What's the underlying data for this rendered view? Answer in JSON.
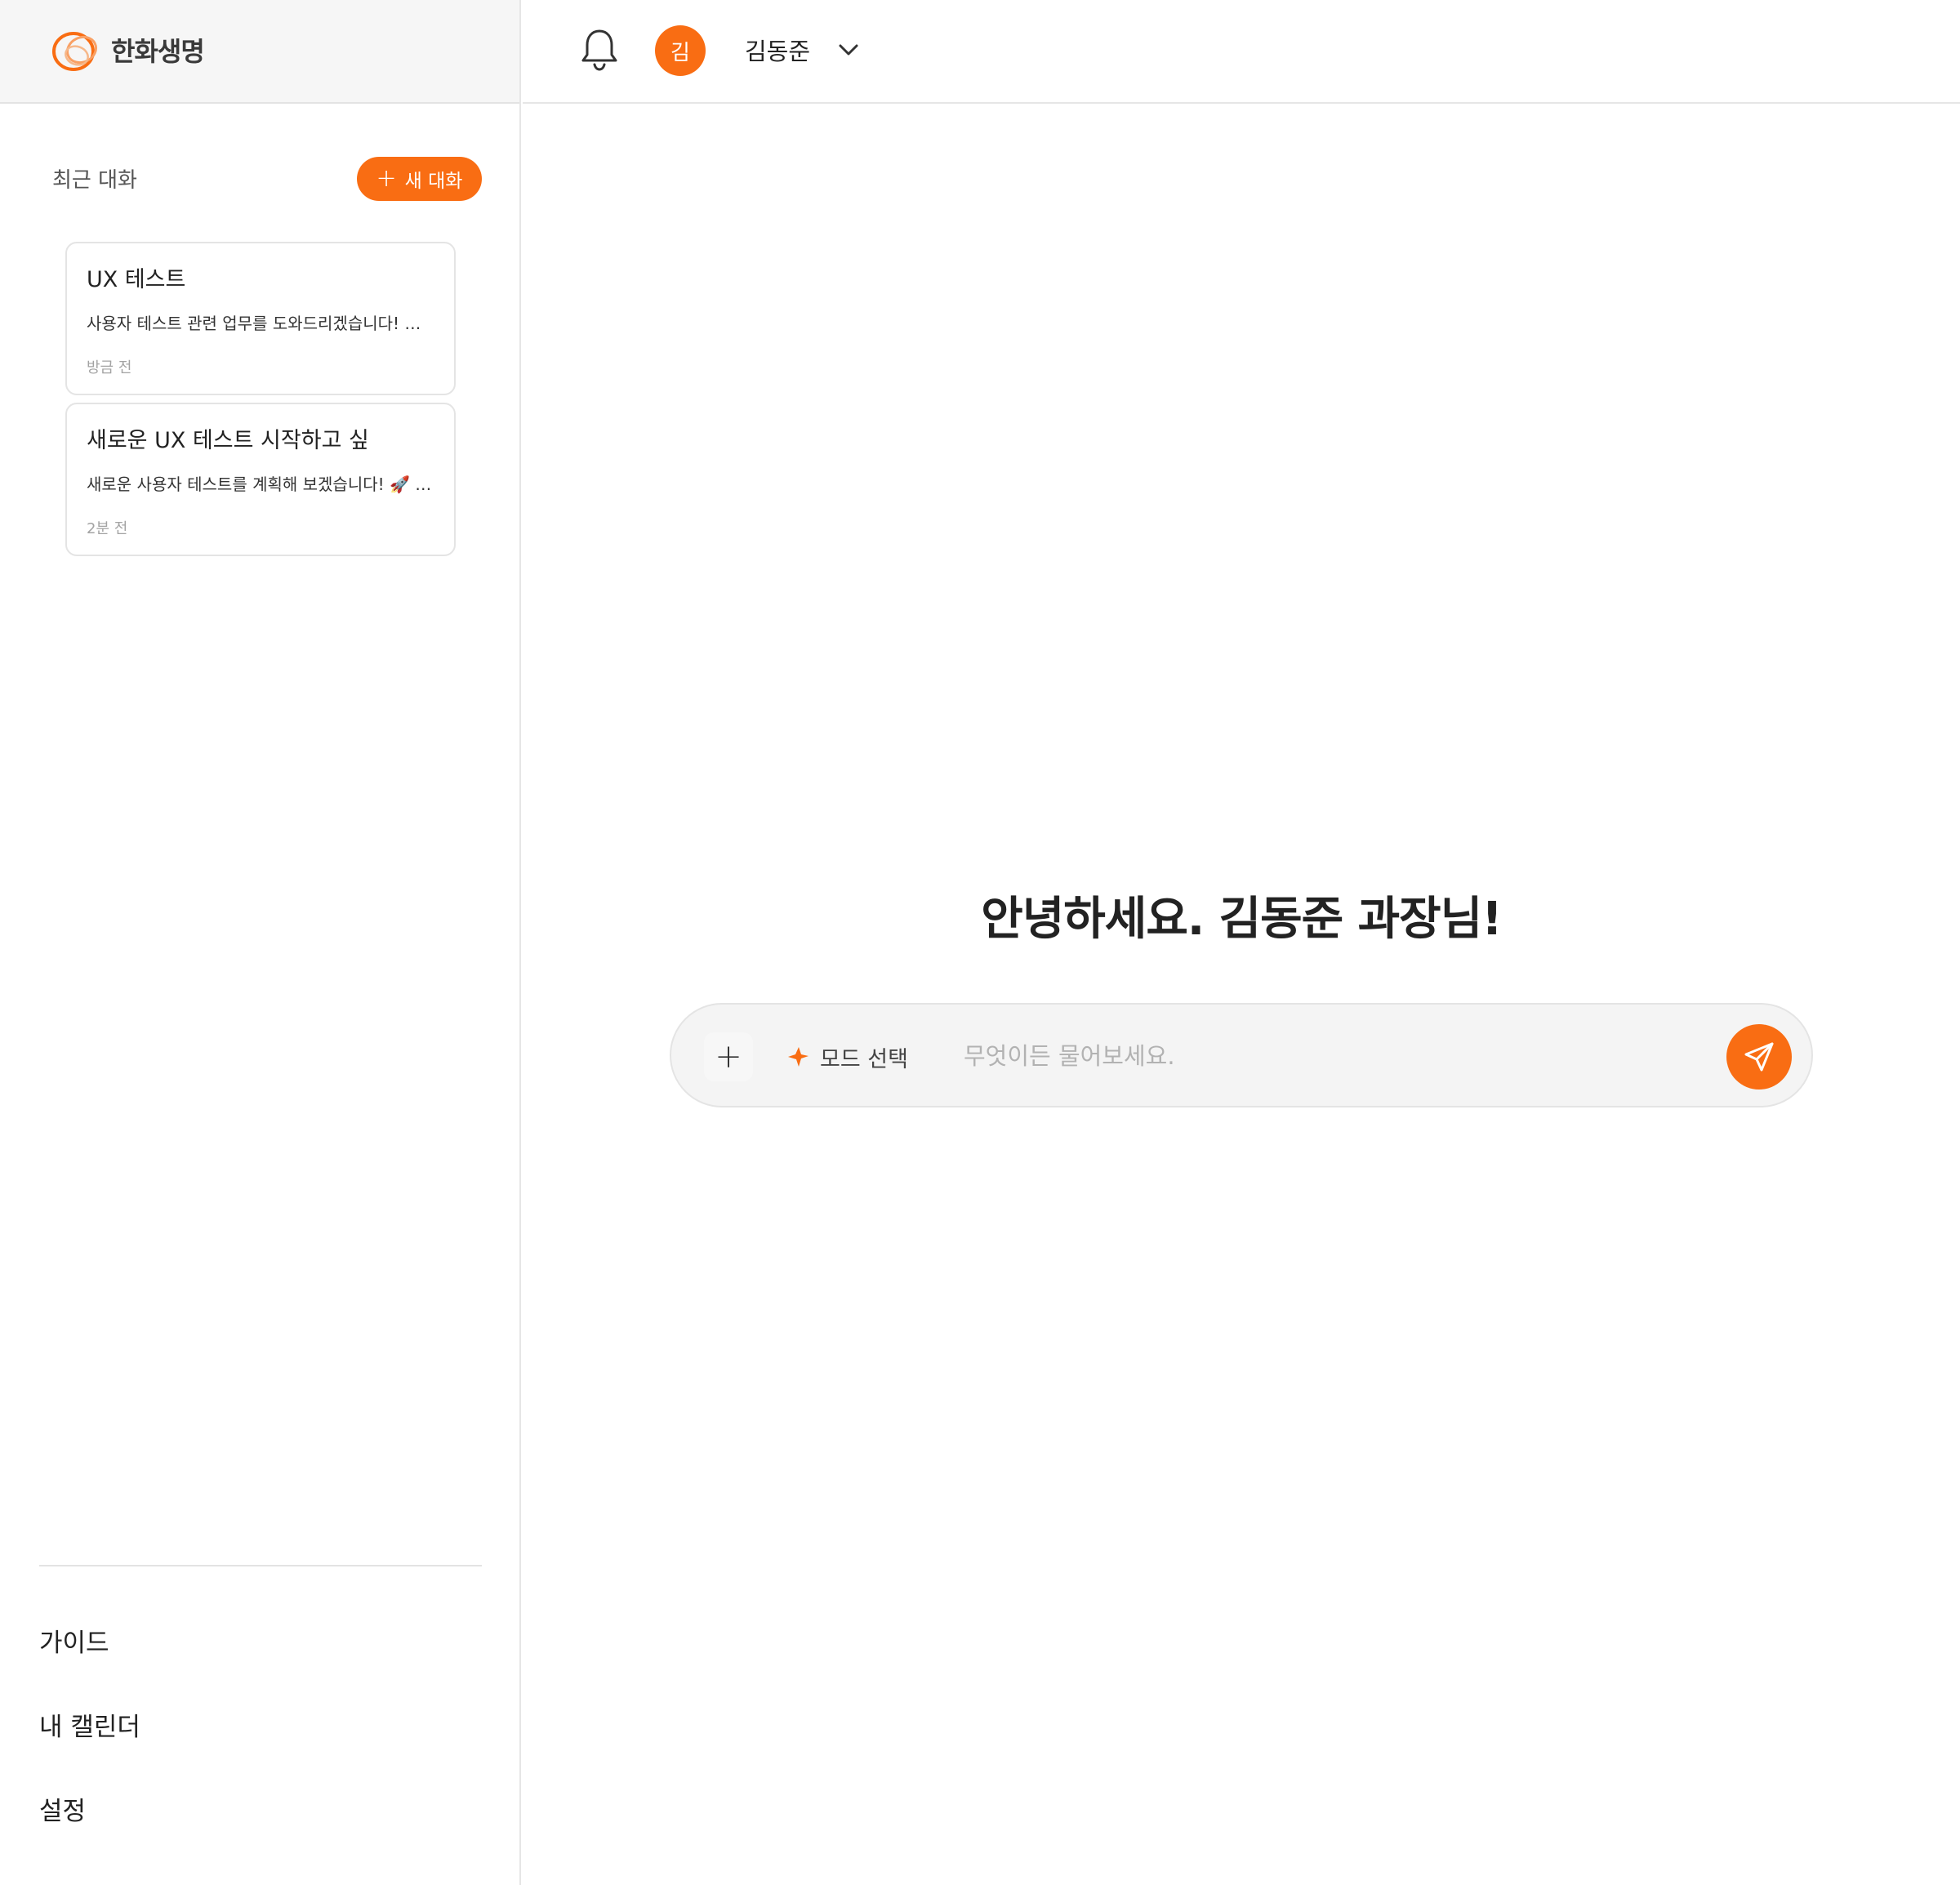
{
  "brand": {
    "name": "한화생명",
    "accent_color": "#f96d13"
  },
  "sidebar": {
    "recent_label": "최근 대화",
    "new_chat_label": "새 대화",
    "conversations": [
      {
        "title": "UX 테스트",
        "preview": "사용자 테스트 관련 업무를 도와드리겠습니다! …",
        "time": "방금 전"
      },
      {
        "title": "새로운 UX 테스트 시작하고 싶",
        "preview": "새로운 사용자 테스트를 계획해 보겠습니다! 🚀 …",
        "time": "2분 전"
      }
    ],
    "links": [
      {
        "label": "가이드"
      },
      {
        "label": "내 캘린더"
      },
      {
        "label": "설정"
      }
    ]
  },
  "header": {
    "notification_icon": "bell-icon",
    "avatar_initial": "김",
    "user_name": "김동준",
    "dropdown_icon": "chevron-down-icon"
  },
  "main": {
    "greeting": "안녕하세요. 김동준 과장님!",
    "composer": {
      "add_icon": "plus-icon",
      "mode_label": "모드 선택",
      "mode_icon": "sparkle-icon",
      "placeholder": "무엇이든 물어보세요.",
      "value": "",
      "send_icon": "send-icon"
    }
  }
}
